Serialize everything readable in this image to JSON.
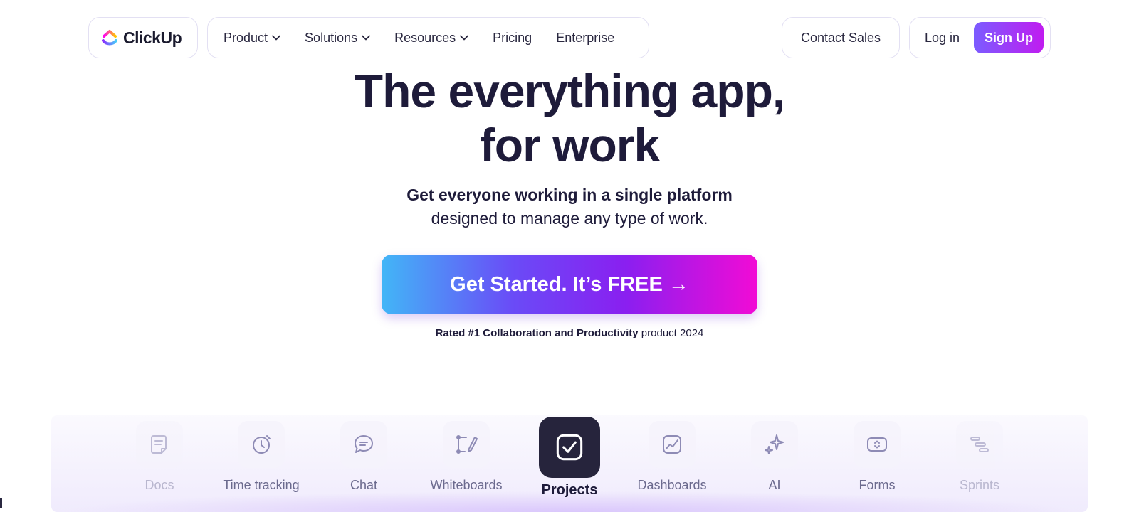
{
  "nav": {
    "logo_text": "ClickUp",
    "menu": [
      {
        "label": "Product",
        "has_dropdown": true
      },
      {
        "label": "Solutions",
        "has_dropdown": true
      },
      {
        "label": "Resources",
        "has_dropdown": true
      },
      {
        "label": "Pricing",
        "has_dropdown": false
      },
      {
        "label": "Enterprise",
        "has_dropdown": false
      }
    ],
    "contact_label": "Contact Sales",
    "login_label": "Log in",
    "signup_label": "Sign Up"
  },
  "hero": {
    "title_line1": "The everything app,",
    "title_line2": "for work",
    "sub_line1": "Get everyone working in a single platform",
    "sub_line2": "designed to manage any type of work.",
    "cta_label": "Get Started. It’s FREE →",
    "rated_bold": "Rated #1 Collaboration and Productivity",
    "rated_rest": " product 2024"
  },
  "features": [
    {
      "label": "Docs",
      "icon": "doc-icon",
      "state": "faded"
    },
    {
      "label": "Time tracking",
      "icon": "clock-icon",
      "state": "normal"
    },
    {
      "label": "Chat",
      "icon": "chat-icon",
      "state": "normal"
    },
    {
      "label": "Whiteboards",
      "icon": "whiteboard-icon",
      "state": "normal"
    },
    {
      "label": "Projects",
      "icon": "checkbox-icon",
      "state": "active"
    },
    {
      "label": "Dashboards",
      "icon": "chart-icon",
      "state": "normal"
    },
    {
      "label": "AI",
      "icon": "sparkle-icon",
      "state": "normal"
    },
    {
      "label": "Forms",
      "icon": "form-icon",
      "state": "normal"
    },
    {
      "label": "Sprints",
      "icon": "sprint-icon",
      "state": "faded"
    }
  ],
  "colors": {
    "text_dark": "#1e1b3a",
    "signup_gradient": [
      "#7b5cff",
      "#c01cf0"
    ],
    "cta_gradient": [
      "#42b6f7",
      "#6a4bf7",
      "#8a1ff0",
      "#f20bd5"
    ],
    "feature_icon": "#8e8bb5",
    "active_tile": "#26243c"
  }
}
